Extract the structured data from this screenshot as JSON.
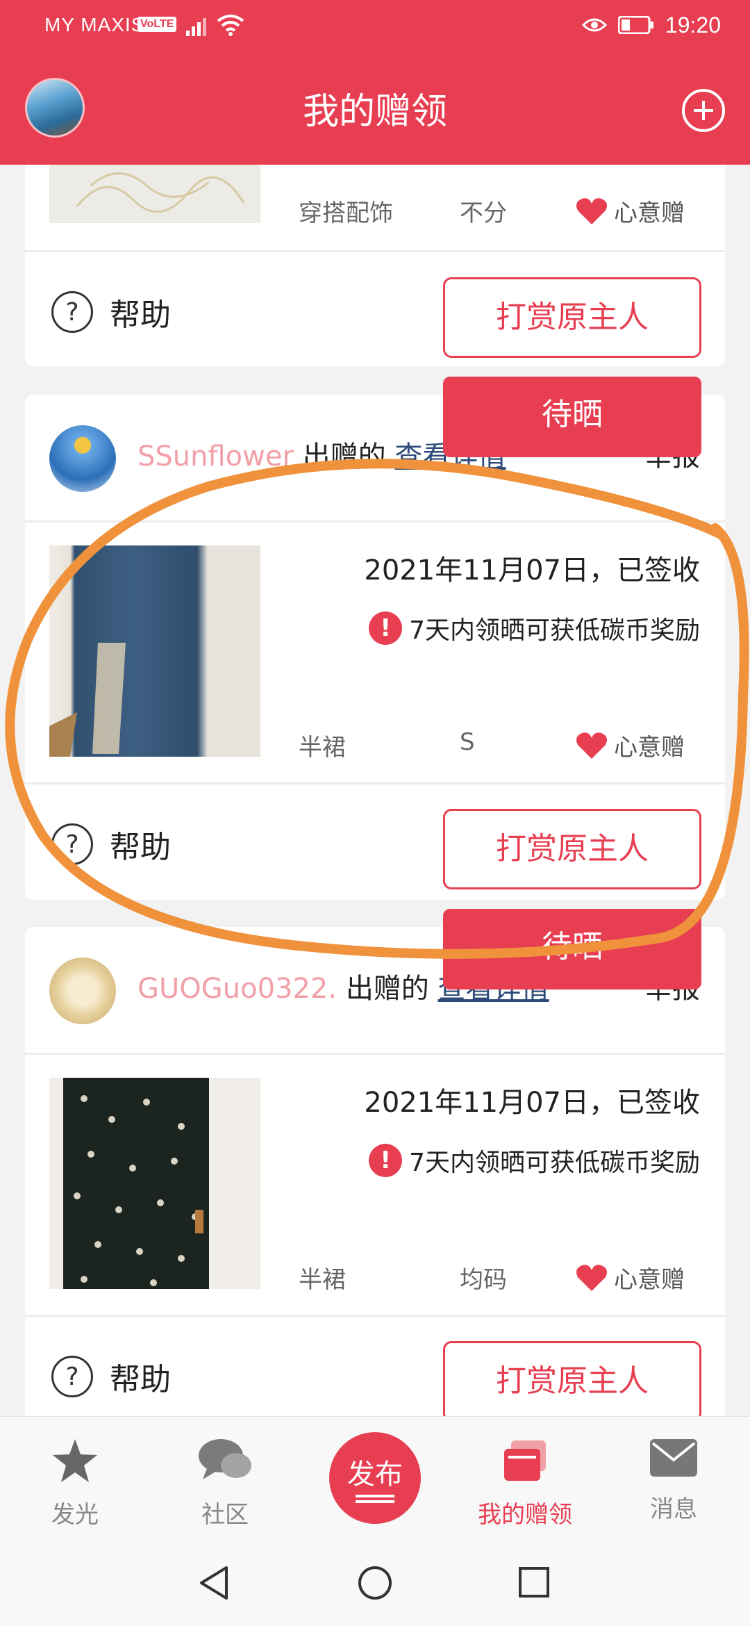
{
  "status_bar": {
    "carrier": "MY MAXIS",
    "volte": "VoLTE",
    "time": "19:20"
  },
  "header": {
    "title": "我的赠领"
  },
  "cards": [
    {
      "category": "穿搭配饰",
      "size": "不分",
      "tag": "心意赠",
      "help_label": "帮助",
      "reward_label": "打赏原主人"
    },
    {
      "pending_label": "待晒",
      "username": "SSunflower",
      "give_text": "出赠的",
      "detail_link": "查看详情",
      "report": "举报",
      "date_status": "2021年11月07日，已签收",
      "notice": "7天内领晒可获低碳币奖励",
      "category": "半裙",
      "size": "S",
      "tag": "心意赠",
      "help_label": "帮助",
      "reward_label": "打赏原主人"
    },
    {
      "pending_label": "待晒",
      "username": "GUOGuo0322.",
      "give_text": "出赠的",
      "detail_link": "查看详情",
      "report": "举报",
      "date_status": "2021年11月07日，已签收",
      "notice": "7天内领晒可获低碳币奖励",
      "category": "半裙",
      "size": "均码",
      "tag": "心意赠",
      "help_label": "帮助",
      "reward_label": "打赏原主人"
    }
  ],
  "bottom_nav": {
    "items": [
      {
        "label": "发光",
        "icon": "star-icon"
      },
      {
        "label": "社区",
        "icon": "chat-bubbles-icon"
      },
      {
        "label": "发布",
        "icon": "publish-icon"
      },
      {
        "label": "我的赠领",
        "icon": "cards-icon"
      },
      {
        "label": "消息",
        "icon": "mail-icon"
      }
    ]
  },
  "colors": {
    "brand": "#e83e52",
    "link": "#2d4a7a",
    "username": "#f2a0a8",
    "annotation": "#f0923b"
  }
}
